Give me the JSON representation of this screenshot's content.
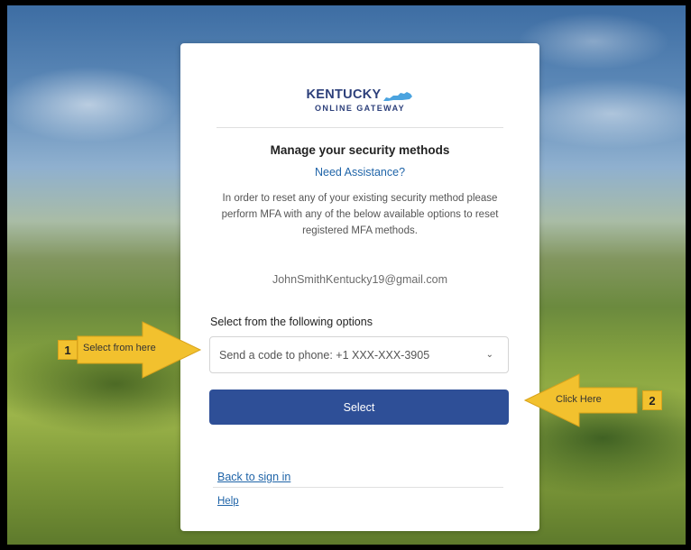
{
  "logo": {
    "line1": "KENTUCKY",
    "line2": "ONLINE GATEWAY"
  },
  "page": {
    "title": "Manage your security methods",
    "assistance_link": "Need Assistance?",
    "description": "In order to reset any of your existing security method please perform MFA with any of the below available options to reset registered MFA methods.",
    "email": "JohnSmithKentucky19@gmail.com",
    "select_label": "Select from the following options",
    "selected_option": "Send a code to phone: +1 XXX-XXX-3905",
    "select_button": "Select",
    "back_link": "Back to sign in",
    "help_link": "Help"
  },
  "annotations": {
    "step1_number": "1",
    "step1_text": "Select from here",
    "step2_number": "2",
    "step2_text": "Click Here",
    "arrow_color": "#f2c12e"
  },
  "colors": {
    "brand_navy": "#2c3f7a",
    "button_blue": "#2e4f97",
    "link_blue": "#1f64a8",
    "kentucky_shape": "#4aa3df"
  }
}
